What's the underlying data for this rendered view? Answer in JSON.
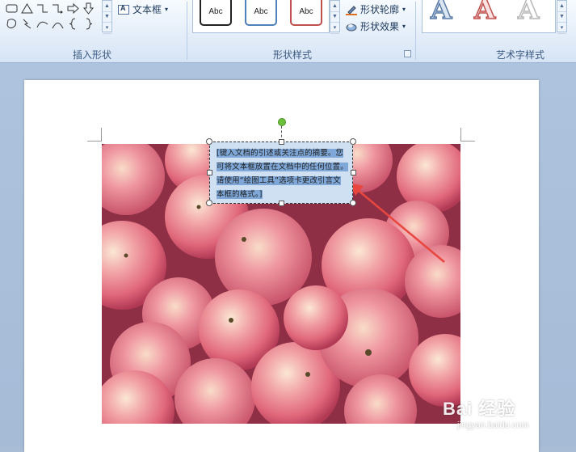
{
  "ribbon": {
    "groups": {
      "insert_shapes": "插入形状",
      "shape_styles": "形状样式",
      "wordart_styles": "艺术字样式"
    },
    "textbox_label": "文本框",
    "style_thumbs": [
      "Abc",
      "Abc",
      "Abc"
    ],
    "shape_outline_label": "形状轮廓",
    "shape_effects_label": "形状效果",
    "wordart_letters": [
      "A",
      "A",
      "A"
    ]
  },
  "document": {
    "textbox_text": "[键入文档的引述或关注点的摘要。您可将文本框放置在文档中的任何位置。请使用“绘图工具”选项卡更改引言文本框的格式。]"
  },
  "watermark": {
    "brand": "Bai 经验",
    "url": "jingyan.baidu.com"
  },
  "colors": {
    "ribbon_bg": "#e3edf9",
    "workspace_bg": "#a9bdd6",
    "textbox_bg": "#cfe0f2",
    "arrow": "#e8463f",
    "rotate_handle": "#6cc23a"
  }
}
